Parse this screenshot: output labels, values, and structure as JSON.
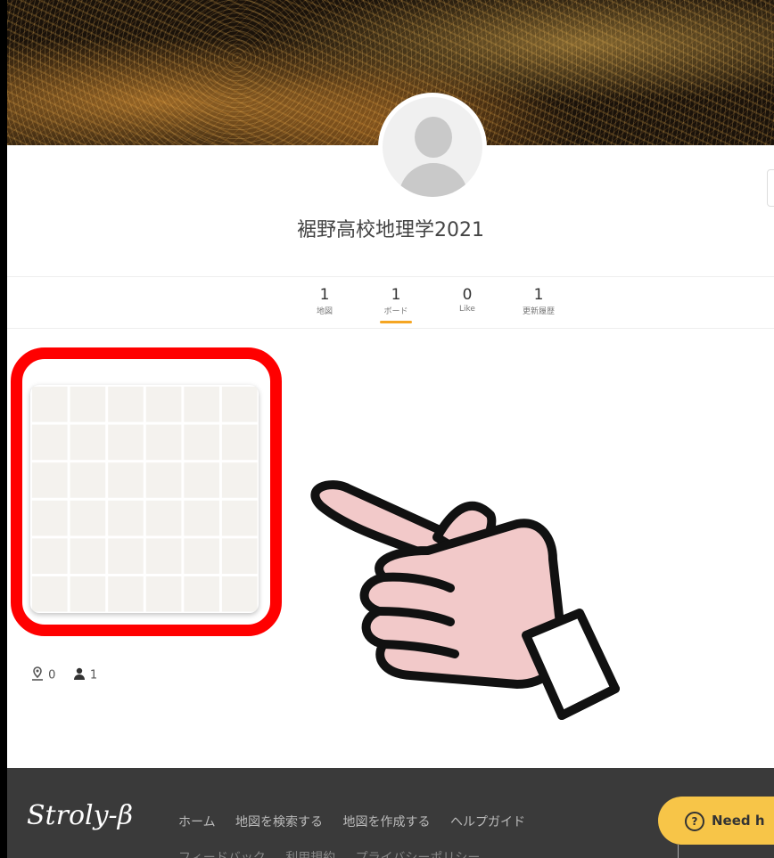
{
  "profile": {
    "name": "裾野高校地理学2021"
  },
  "stats": [
    {
      "count": "1",
      "label": "地図"
    },
    {
      "count": "1",
      "label": "ボード"
    },
    {
      "count": "0",
      "label": "Like"
    },
    {
      "count": "1",
      "label": "更新履歴"
    }
  ],
  "active_tab_index": 1,
  "board_card": {
    "pin_count": "0",
    "member_count": "1"
  },
  "footer": {
    "logo": "Stroly-β",
    "nav": [
      "ホーム",
      "地図を検索する",
      "地図を作成する",
      "ヘルプガイド"
    ],
    "nav2": [
      "フィードバック",
      "利用規約",
      "プライバシーポリシー"
    ],
    "help_button": "Need h"
  },
  "icons": {
    "pin": "map-pin-person-icon",
    "member": "person-icon",
    "help": "question-circle-icon",
    "pointer": "pointing-hand-icon"
  },
  "colors": {
    "highlight": "#ff0000",
    "active_tab": "#f5a623",
    "help_button": "#f7c548",
    "footer_bg": "#3a3a3a"
  }
}
